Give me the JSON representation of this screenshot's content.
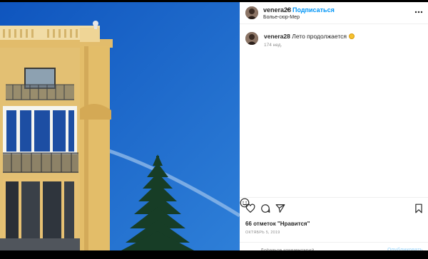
{
  "post": {
    "username": "venera28",
    "separator": "•",
    "follow_label": "Подписаться",
    "location": "Болье-сюр-Мер"
  },
  "caption": {
    "username": "venera28",
    "text": "Лето продолжается",
    "emoji": "sun-emoji",
    "age": "174 нед."
  },
  "actions": {
    "icons": [
      "heart-icon",
      "comment-icon",
      "share-icon",
      "bookmark-icon"
    ],
    "likes": "66 отметок \"Нравится\"",
    "date": "ОКТЯБРЬ 5, 2019"
  },
  "comment": {
    "placeholder": "Добавьте комментарий...",
    "publish_label": "Опубликовать"
  },
  "colors": {
    "sky": "#1f67c9",
    "link": "#0095f6",
    "publish_disabled": "#b2dffc"
  }
}
